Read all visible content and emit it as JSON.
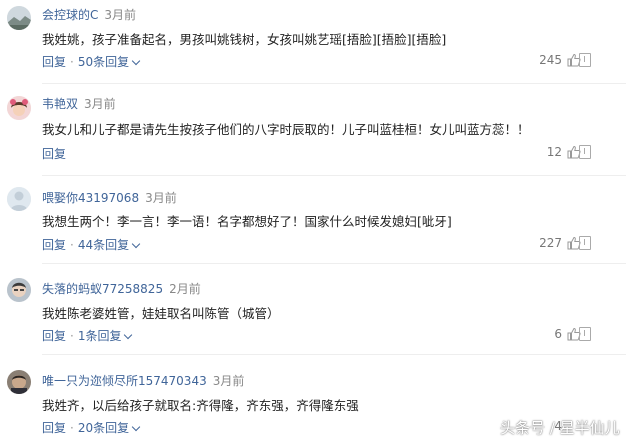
{
  "comments": [
    {
      "user": "会控球的C",
      "time": "3月前",
      "text": "我姓姚，孩子准备起名，男孩叫姚钱树，女孩叫姚艺瑶[捂脸][捂脸][捂脸]",
      "reply_label": "回复",
      "replies_label": "50条回复",
      "likes": "245",
      "avatar": "landscape"
    },
    {
      "user": "韦艳双",
      "time": "3月前",
      "text": "我女儿和儿子都是请先生按孩子他们的八字时辰取的！儿子叫蓝桂桓！女儿叫蓝方蕊！！",
      "reply_label": "回复",
      "replies_label": "",
      "likes": "12",
      "avatar": "girl"
    },
    {
      "user": "喂娶你43197068",
      "time": "3月前",
      "text": "我想生两个！李一言！李一语！名字都想好了！国家什么时候发媳妇[呲牙]",
      "reply_label": "回复",
      "replies_label": "44条回复",
      "likes": "227",
      "avatar": "default"
    },
    {
      "user": "失落的蚂蚁77258825",
      "time": "2月前",
      "text": "我姓陈老婆姓管，娃娃取名叫陈管（城管）",
      "reply_label": "回复",
      "replies_label": "1条回复",
      "likes": "6",
      "avatar": "face"
    },
    {
      "user": "唯一只为迩倾尽所157470343",
      "time": "3月前",
      "text": "我姓齐，以后给孩子就取名:齐得隆，齐东强，齐得隆东强",
      "reply_label": "回复",
      "replies_label": "20条回复",
      "likes": "4",
      "avatar": "man"
    }
  ],
  "watermark": "头条号 / 星半仙儿",
  "colors": {
    "link": "#406599",
    "meta": "#888888",
    "divider": "#eeeeee"
  }
}
